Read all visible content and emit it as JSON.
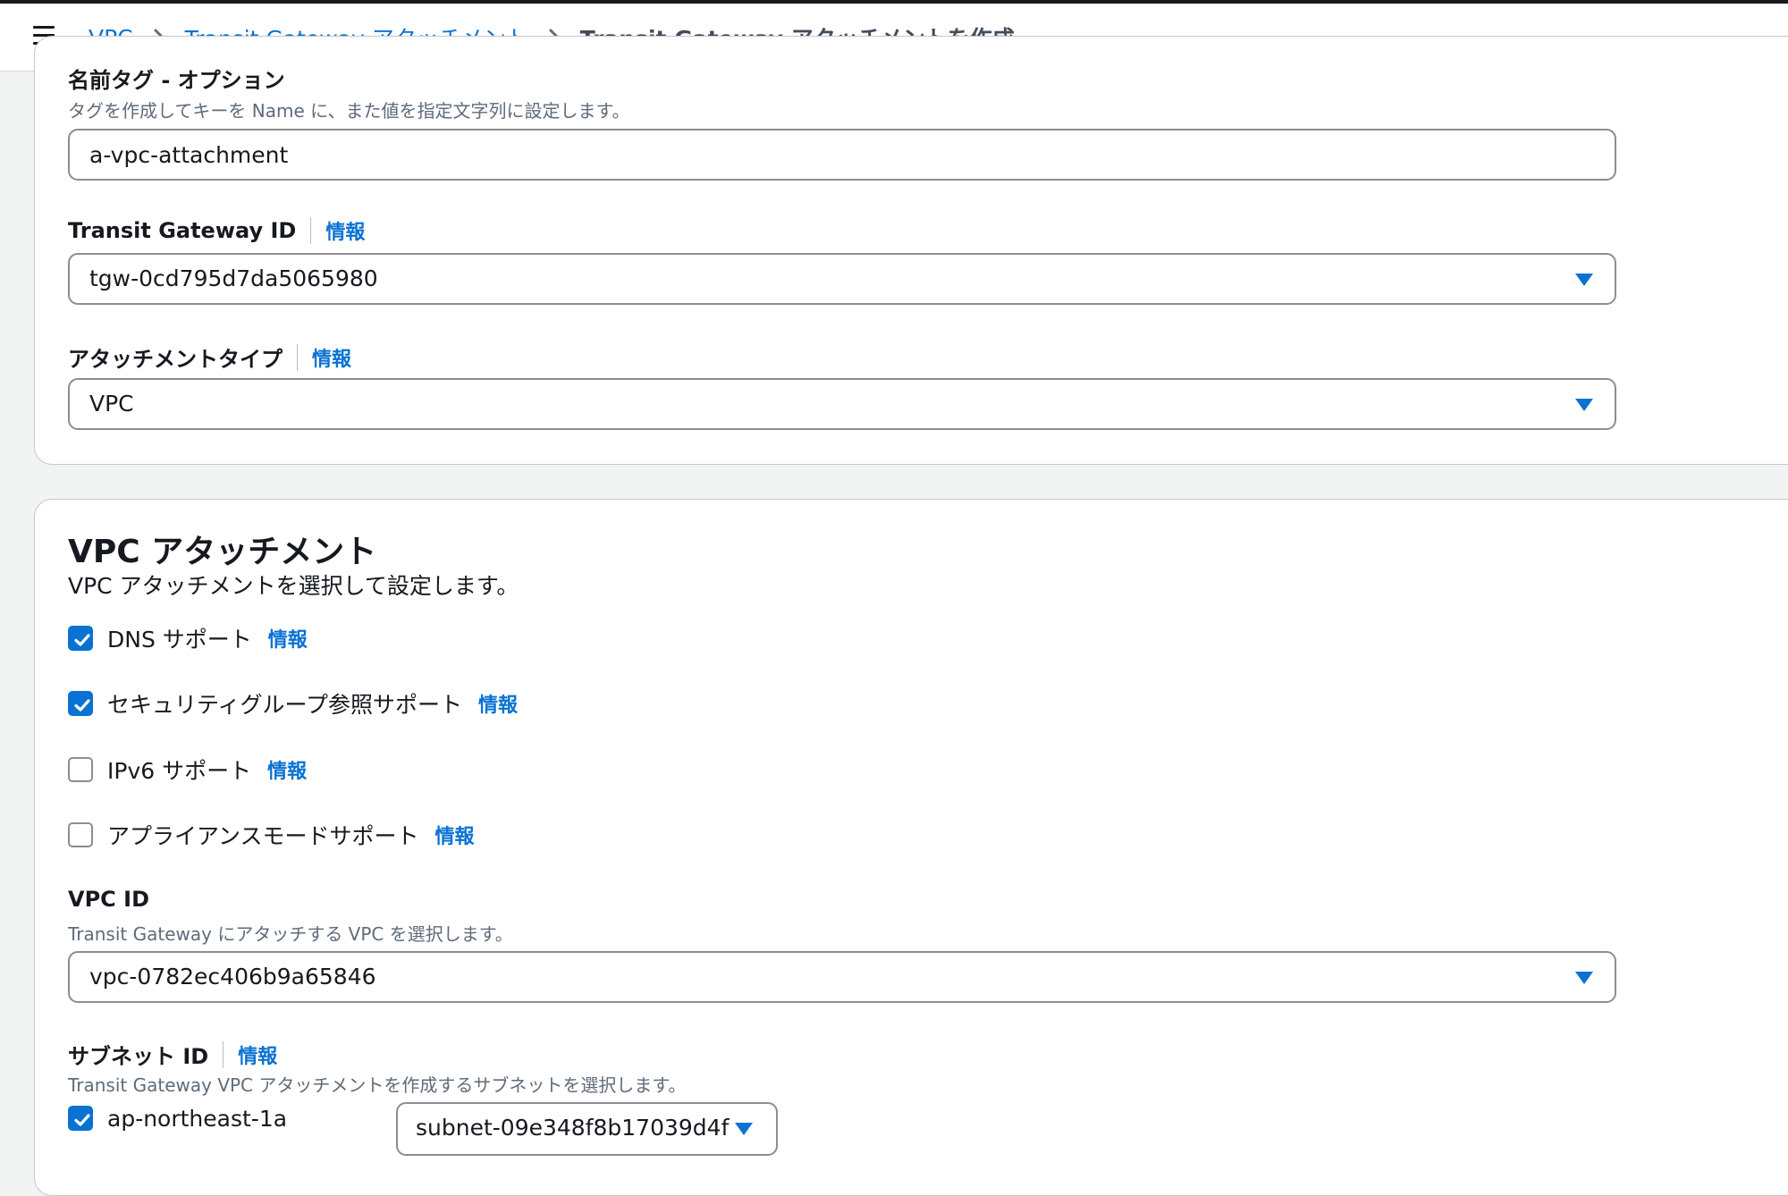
{
  "breadcrumbs": [
    {
      "label": "VPC"
    },
    {
      "label": "Transit Gateway アタッチメント"
    },
    {
      "label": "Transit Gateway アタッチメントを作成"
    }
  ],
  "details": {
    "name_tag": {
      "label": "名前タグ - オプション",
      "description": "タグを作成してキーを Name に、また値を指定文字列に設定します。",
      "value": "a-vpc-attachment"
    },
    "transit_gateway_id": {
      "label": "Transit Gateway ID",
      "info": "情報",
      "value": "tgw-0cd795d7da5065980"
    },
    "attachment_type": {
      "label": "アタッチメントタイプ",
      "info": "情報",
      "value": "VPC"
    }
  },
  "vpc_attachment": {
    "title": "VPC アタッチメント",
    "description": "VPC アタッチメントを選択して設定します。",
    "options": [
      {
        "label": "DNS サポート",
        "info": "情報",
        "checked": true
      },
      {
        "label": "セキュリティグループ参照サポート",
        "info": "情報",
        "checked": true
      },
      {
        "label": "IPv6 サポート",
        "info": "情報",
        "checked": false
      },
      {
        "label": "アプライアンスモードサポート",
        "info": "情報",
        "checked": false
      }
    ],
    "vpc_id": {
      "label": "VPC ID",
      "description": "Transit Gateway にアタッチする VPC を選択します。",
      "value": "vpc-0782ec406b9a65846"
    },
    "subnet_id": {
      "label": "サブネット ID",
      "info": "情報",
      "description": "Transit Gateway VPC アタッチメントを作成するサブネットを選択します。",
      "zones": [
        {
          "az": "ap-northeast-1a",
          "checked": true,
          "subnet": "subnet-09e348f8b17039d4f"
        }
      ]
    }
  },
  "icons": [
    "menu-icon",
    "chevron-right-icon",
    "caret-down-icon",
    "checkmark-icon"
  ],
  "colors": {
    "link": "#0972d3",
    "border": "#8c8c94",
    "background": "#f2f3f3",
    "text": "#16191f",
    "muted": "#5f6b7a"
  }
}
